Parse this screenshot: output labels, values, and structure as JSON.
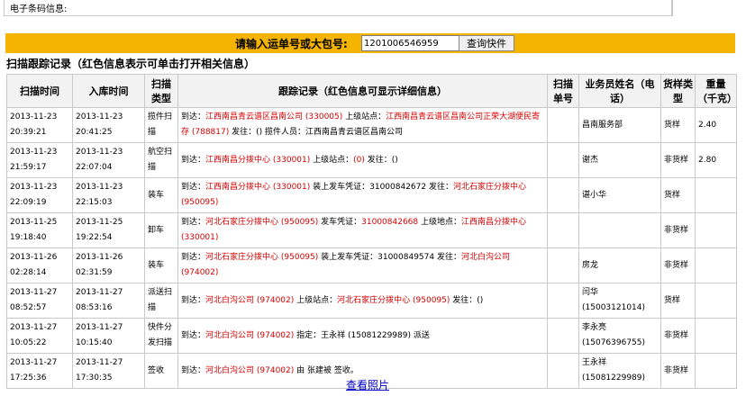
{
  "barcode_label": "电子条码信息:",
  "search": {
    "label": "请输入运单号或大包号:",
    "value": "1201006546959",
    "button": "查询快件"
  },
  "section_title": "扫描跟踪记录（红色信息表示可单击打开相关信息）",
  "columns": [
    "扫描时间",
    "入库时间",
    "扫描类型",
    "跟踪记录（红色信息可显示详细信息）",
    "扫描单号",
    "业务员姓名（电话）",
    "货样类型",
    "重量（千克）"
  ],
  "rows": [
    {
      "scan_time": "2013-11-23 20:39:21",
      "in_time": "2013-11-23 20:41:25",
      "type": "揽件扫描",
      "track": [
        [
          "到达：",
          ""
        ],
        [
          "江西南昌青云谱区昌南公司 (330005)",
          "red"
        ],
        [
          " 上级站点：",
          ""
        ],
        [
          "江西南昌青云谱区昌南公司正荣大湖便民寄存 (788817)",
          "red"
        ],
        [
          " 发往：() 揽件人员：江西南昌青云谱区昌南公司",
          ""
        ]
      ],
      "scan_no": "",
      "staff": "昌南服务部",
      "goods": "货样",
      "weight": "2.40"
    },
    {
      "scan_time": "2013-11-23 21:59:17",
      "in_time": "2013-11-23 22:07:04",
      "type": "航空扫描",
      "track": [
        [
          "到达：",
          ""
        ],
        [
          "江西南昌分拨中心 (330001)",
          "red"
        ],
        [
          " 上级站点：",
          ""
        ],
        [
          "(0)",
          "red"
        ],
        [
          " 发往：()",
          ""
        ]
      ],
      "scan_no": "",
      "staff": "谢杰",
      "goods": "非货样",
      "weight": "2.80"
    },
    {
      "scan_time": "2013-11-23 22:09:19",
      "in_time": "2013-11-23 22:15:03",
      "type": "装车",
      "track": [
        [
          "到达：",
          ""
        ],
        [
          "江西南昌分拨中心 (330001)",
          "red"
        ],
        [
          " 装上发车凭证：31000842672 发往：",
          ""
        ],
        [
          "河北石家庄分拨中心 (950095)",
          "red"
        ]
      ],
      "scan_no": "",
      "staff": "谌小华",
      "goods": "货样",
      "weight": ""
    },
    {
      "scan_time": "2013-11-25 19:18:40",
      "in_time": "2013-11-25 19:22:54",
      "type": "卸车",
      "track": [
        [
          "到达：",
          ""
        ],
        [
          "河北石家庄分拨中心 (950095)",
          "red"
        ],
        [
          " 发车凭证：",
          ""
        ],
        [
          "31000842668",
          "red"
        ],
        [
          " 上级地点：",
          ""
        ],
        [
          "江西南昌分拨中心 (330001)",
          "red"
        ]
      ],
      "scan_no": "",
      "staff": "",
      "goods": "非货样",
      "weight": ""
    },
    {
      "scan_time": "2013-11-26 02:28:14",
      "in_time": "2013-11-26 02:31:59",
      "type": "装车",
      "track": [
        [
          "到达：",
          ""
        ],
        [
          "河北石家庄分拨中心 (950095)",
          "red"
        ],
        [
          " 装上发车凭证：31000849574 发往：",
          ""
        ],
        [
          "河北白沟公司 (974002)",
          "red"
        ]
      ],
      "scan_no": "",
      "staff": "房龙",
      "goods": "非货样",
      "weight": ""
    },
    {
      "scan_time": "2013-11-27 08:52:57",
      "in_time": "2013-11-27 08:53:16",
      "type": "派送扫描",
      "track": [
        [
          "到达：",
          ""
        ],
        [
          "河北白沟公司 (974002)",
          "red"
        ],
        [
          " 上级站点：",
          ""
        ],
        [
          "河北石家庄分拨中心 (950095)",
          "red"
        ],
        [
          " 发往：()",
          ""
        ]
      ],
      "scan_no": "",
      "staff": "闫华 (15003121014)",
      "goods": "货样",
      "weight": ""
    },
    {
      "scan_time": "2013-11-27 10:05:22",
      "in_time": "2013-11-27 10:15:40",
      "type": "快件分发扫描",
      "track": [
        [
          "到达：",
          ""
        ],
        [
          "河北白沟公司 (974002)",
          "red"
        ],
        [
          " 指定：王永祥 (15081229989) 派送",
          ""
        ]
      ],
      "scan_no": "",
      "staff": "李永亮 (15076396755)",
      "goods": "非货样",
      "weight": ""
    },
    {
      "scan_time": "2013-11-27 17:25:36",
      "in_time": "2013-11-27 17:30:35",
      "type": "签收",
      "track": [
        [
          "到达：",
          ""
        ],
        [
          "河北白沟公司 (974002)",
          "red"
        ],
        [
          " 由 张建被 签收。",
          ""
        ]
      ],
      "scan_no": "",
      "staff": "王永祥 (15081229989)",
      "goods": "非货样",
      "weight": ""
    }
  ],
  "photo_link": "查看照片",
  "colors": {
    "search_bar": "#f5b400",
    "link_red": "#d40000",
    "link_blue": "#0000cc"
  }
}
